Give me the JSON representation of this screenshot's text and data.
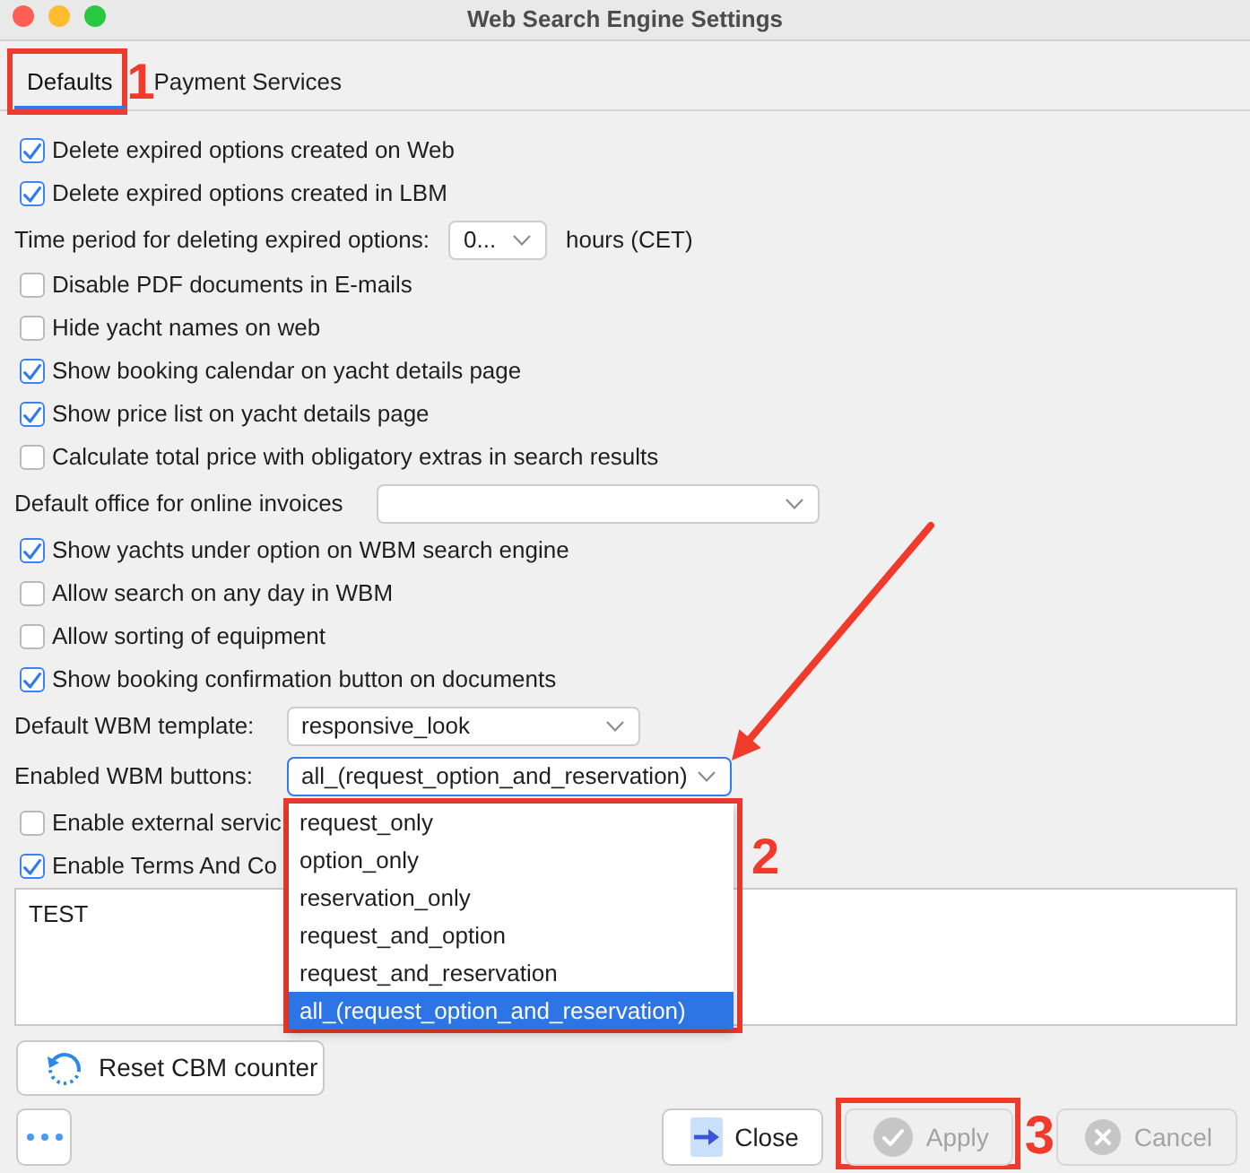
{
  "window": {
    "title": "Web Search Engine Settings"
  },
  "tabs": [
    {
      "label": "Defaults",
      "selected": true,
      "callout": "1"
    },
    {
      "label": "Payment Services",
      "selected": false
    }
  ],
  "settings": [
    {
      "kind": "checkbox",
      "label": "Delete expired options created on Web",
      "checked": true
    },
    {
      "kind": "checkbox",
      "label": "Delete expired options created in LBM",
      "checked": true
    },
    {
      "kind": "select",
      "label": "Time period for deleting expired options:",
      "value": "0...",
      "unit": "hours (CET)"
    },
    {
      "kind": "checkbox",
      "label": "Disable PDF documents in E-mails",
      "checked": false
    },
    {
      "kind": "checkbox",
      "label": "Hide yacht names on web",
      "checked": false
    },
    {
      "kind": "checkbox",
      "label": "Show booking calendar on yacht details page",
      "checked": true
    },
    {
      "kind": "checkbox",
      "label": "Show price list on yacht details page",
      "checked": true
    },
    {
      "kind": "checkbox",
      "label": "Calculate total price with obligatory extras in search results",
      "checked": false
    },
    {
      "kind": "select",
      "label": "Default office for online invoices"
    },
    {
      "kind": "checkbox",
      "label": "Show yachts under option on WBM search engine",
      "checked": true
    },
    {
      "kind": "checkbox",
      "label": "Allow search on any day in WBM",
      "checked": false
    },
    {
      "kind": "checkbox",
      "label": "Allow sorting of equipment",
      "checked": false
    },
    {
      "kind": "checkbox",
      "label": "Show booking confirmation button on documents",
      "checked": true
    },
    {
      "kind": "select",
      "label": "Default WBM template:",
      "value": "responsive_look"
    },
    {
      "kind": "select",
      "label": "Enabled WBM buttons:",
      "value": "all_(request_option_and_reservation)",
      "focused": true,
      "expanded": true,
      "callout": "2",
      "options": [
        {
          "label": "request_only",
          "selected": false
        },
        {
          "label": "option_only",
          "selected": false
        },
        {
          "label": "reservation_only",
          "selected": false
        },
        {
          "label": "request_and_option",
          "selected": false
        },
        {
          "label": "request_and_reservation",
          "selected": false
        },
        {
          "label": "all_(request_option_and_reservation)",
          "selected": true
        }
      ]
    },
    {
      "kind": "checkbox",
      "label": "Enable external servic",
      "checked": false
    },
    {
      "kind": "checkbox",
      "label": "Enable Terms And Co",
      "checked": true
    },
    {
      "kind": "textarea",
      "value": "TEST"
    },
    {
      "kind": "button",
      "label": "Reset CBM counter"
    }
  ],
  "footer": {
    "buttons": [
      {
        "kind": "more"
      },
      {
        "kind": "close",
        "label": "Close",
        "disabled": false
      },
      {
        "kind": "apply",
        "label": "Apply",
        "disabled": true,
        "callout": "3"
      },
      {
        "kind": "cancel",
        "label": "Cancel",
        "disabled": true
      }
    ]
  }
}
